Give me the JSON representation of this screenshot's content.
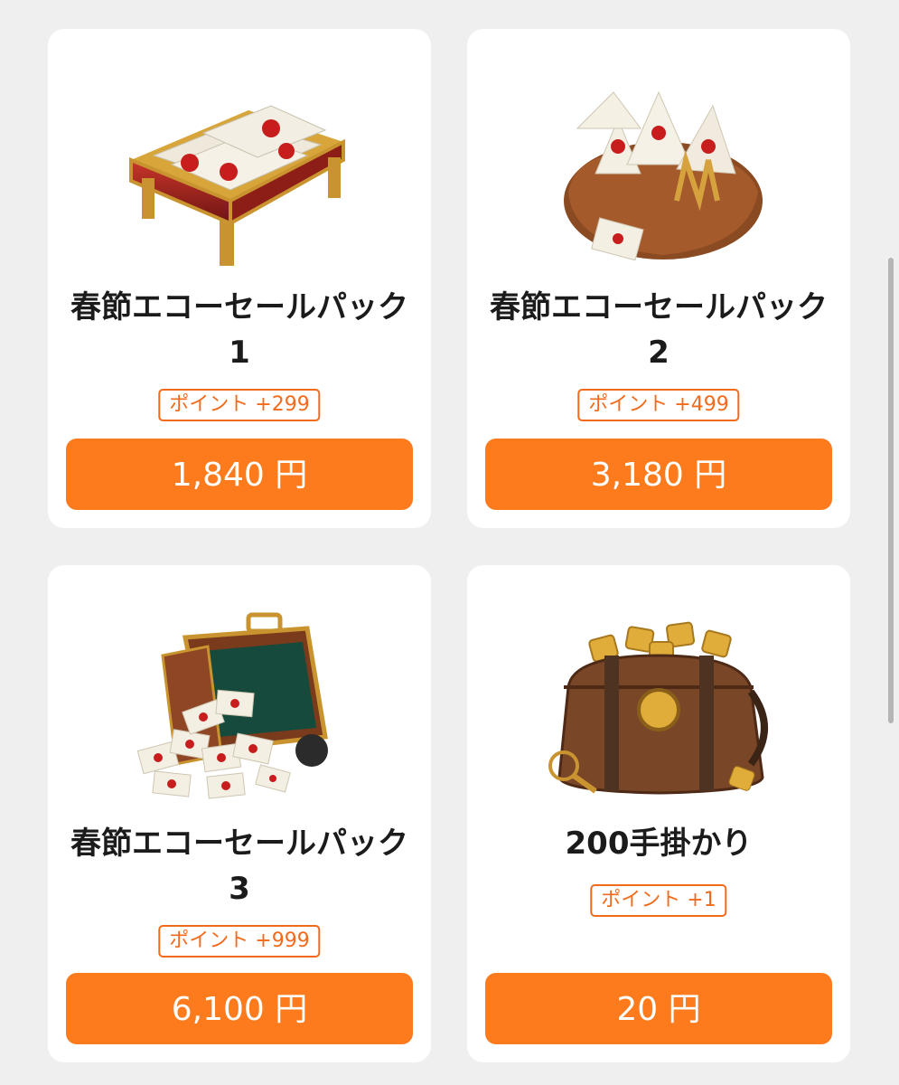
{
  "products": [
    {
      "title_line1": "春節エコーセールパック",
      "title_line2": "1",
      "badge": "ポイント +299",
      "price": "1,840 円",
      "icon": "envelope-table-icon"
    },
    {
      "title_line1": "春節エコーセールパック",
      "title_line2": "2",
      "badge": "ポイント +499",
      "price": "3,180 円",
      "icon": "envelope-bag-icon"
    },
    {
      "title_line1": "春節エコーセールパック",
      "title_line2": "3",
      "badge": "ポイント +999",
      "price": "6,100 円",
      "icon": "envelope-suitcase-icon"
    },
    {
      "title_line1": "200手掛かり",
      "title_line2": "",
      "badge": "ポイント +1",
      "price": "20 円",
      "icon": "puzzle-bag-icon"
    }
  ],
  "colors": {
    "accent": "#fd7b1d",
    "badge": "#f26a1c",
    "background": "#efefef"
  }
}
